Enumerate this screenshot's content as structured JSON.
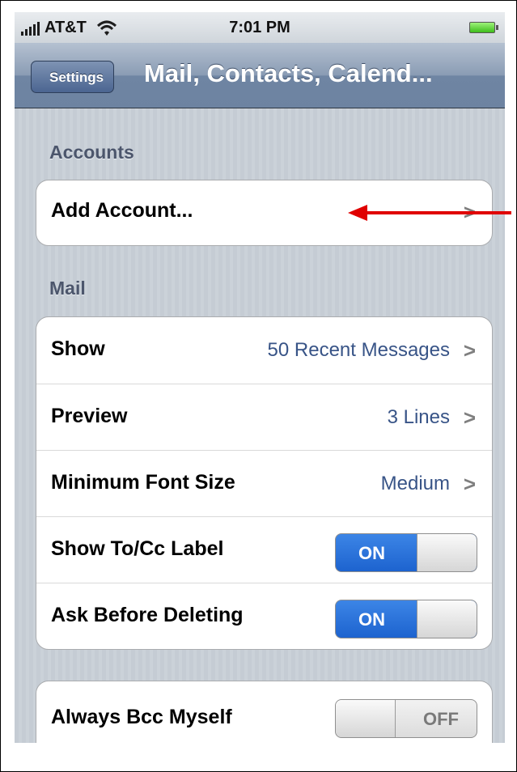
{
  "status_bar": {
    "carrier": "AT&T",
    "time": "7:01 PM"
  },
  "nav": {
    "back_label": "Settings",
    "title": "Mail, Contacts, Calend..."
  },
  "accounts": {
    "header": "Accounts",
    "add_account": {
      "label": "Add Account..."
    }
  },
  "mail": {
    "header": "Mail",
    "rows": [
      {
        "label": "Show",
        "value": "50 Recent Messages"
      },
      {
        "label": "Preview",
        "value": "3 Lines"
      },
      {
        "label": "Minimum Font Size",
        "value": "Medium"
      }
    ],
    "toggles": [
      {
        "label": "Show To/Cc Label",
        "state": "ON"
      },
      {
        "label": "Ask Before Deleting",
        "state": "ON"
      }
    ]
  },
  "bcc": {
    "label": "Always Bcc Myself",
    "state": "OFF"
  },
  "chevron_glyph": ">",
  "colors": {
    "annotation_arrow": "#e00000",
    "toggle_on": "#1d63cf",
    "value_text": "#385487"
  }
}
